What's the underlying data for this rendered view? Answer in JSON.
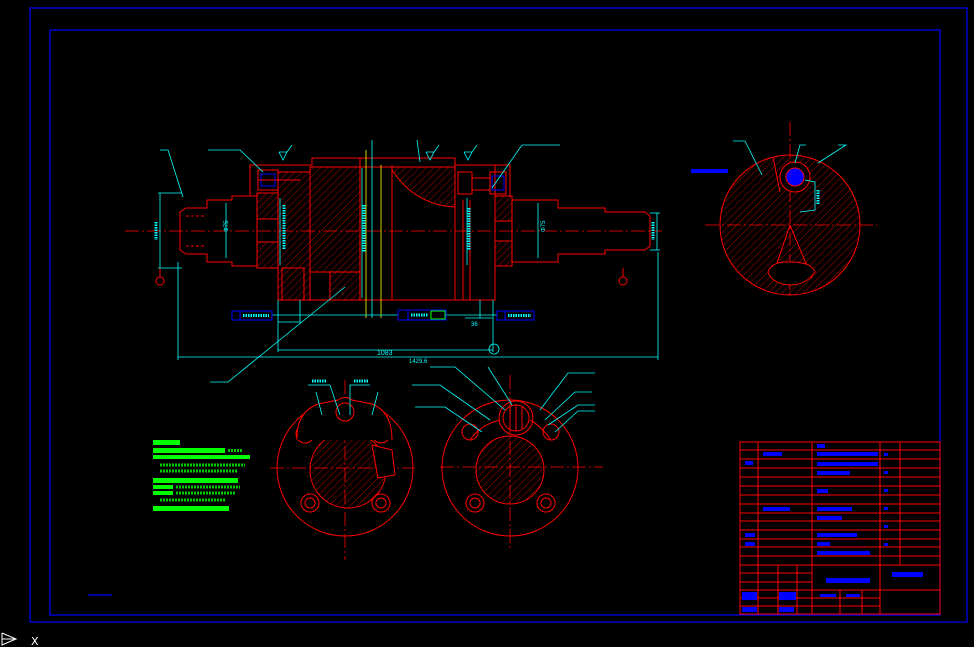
{
  "dimensions": {
    "overall_length": "1429.6",
    "span_length": "1083",
    "offset": "36",
    "journal_dia_left": "Φ75",
    "journal_dia_right": "Φ75"
  },
  "ucs": {
    "icon": "ucs-icon",
    "x_axis_label": "X"
  },
  "colors": {
    "background": "#000000",
    "frame": "#0000ff",
    "outline": "#ff0000",
    "dimension": "#00ffff",
    "notes": "#00ff00",
    "text_fill": "#0000ff",
    "center": "#ffff00",
    "ucs": "#ffffff"
  }
}
